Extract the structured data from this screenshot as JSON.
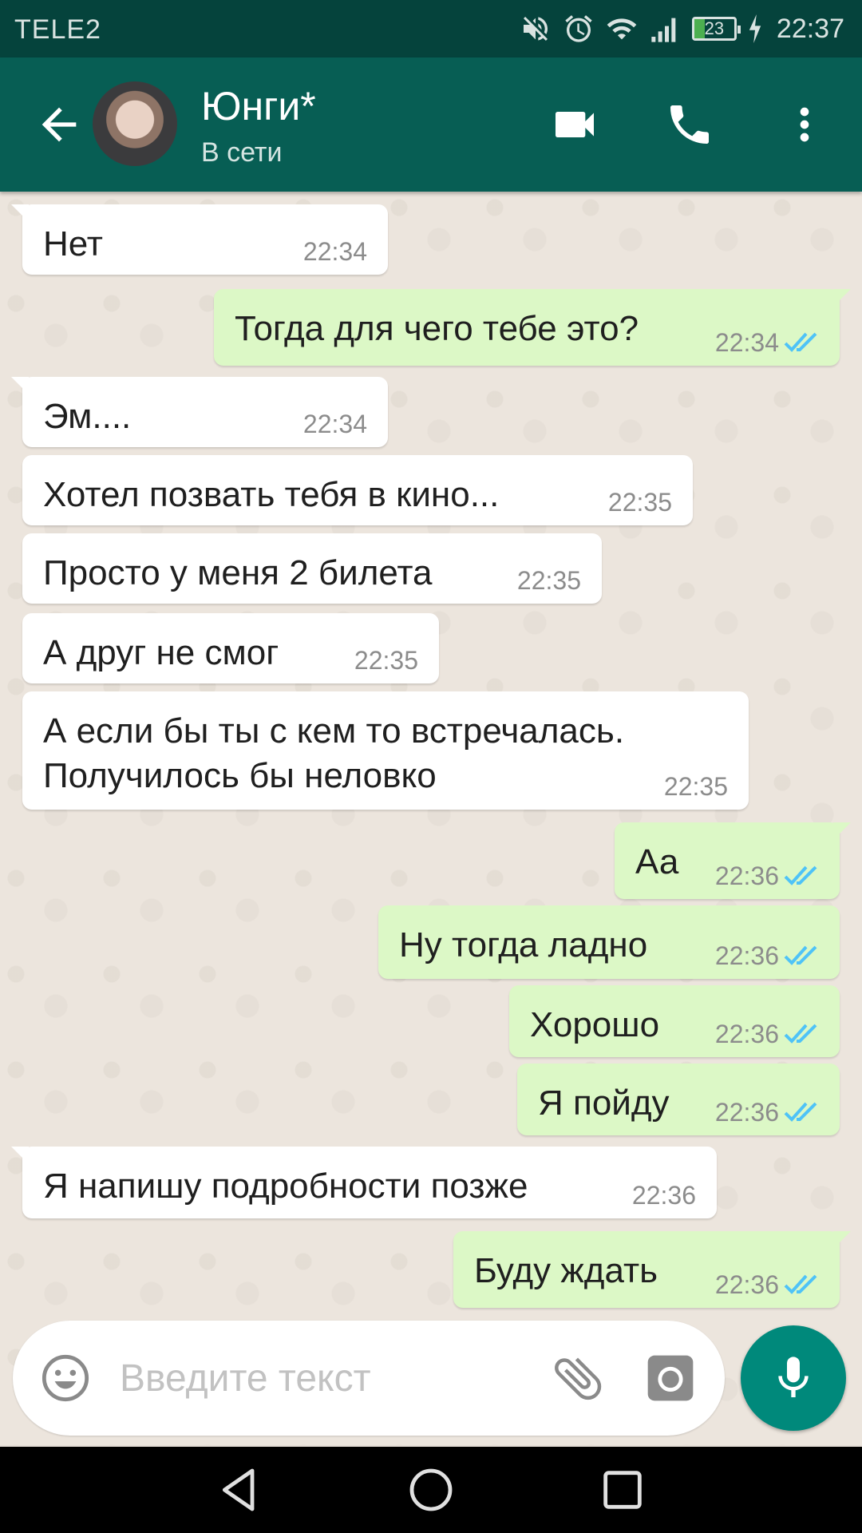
{
  "status_bar": {
    "carrier": "TELE2",
    "battery": "23",
    "time": "22:37"
  },
  "header": {
    "contact_name": "Юнги*",
    "contact_status": "В сети"
  },
  "messages": [
    {
      "dir": "in",
      "text": "Нет",
      "time": "22:34"
    },
    {
      "dir": "out",
      "text": "Тогда для чего тебе это?",
      "time": "22:34",
      "read": true
    },
    {
      "dir": "in",
      "text": "Эм....",
      "time": "22:34"
    },
    {
      "dir": "in",
      "text": "Хотел позвать тебя в кино...",
      "time": "22:35"
    },
    {
      "dir": "in",
      "text": "Просто у меня 2 билета",
      "time": "22:35"
    },
    {
      "dir": "in",
      "text": "А друг не смог",
      "time": "22:35"
    },
    {
      "dir": "in",
      "text": "А если бы ты с кем то встречалась.\nПолучилось бы неловко",
      "time": "22:35"
    },
    {
      "dir": "out",
      "text": "Аа",
      "time": "22:36",
      "read": true
    },
    {
      "dir": "out",
      "text": "Ну тогда ладно",
      "time": "22:36",
      "read": true
    },
    {
      "dir": "out",
      "text": "Хорошо",
      "time": "22:36",
      "read": true
    },
    {
      "dir": "out",
      "text": "Я пойду",
      "time": "22:36",
      "read": true
    },
    {
      "dir": "in",
      "text": "Я напишу подробности позже",
      "time": "22:36"
    },
    {
      "dir": "out",
      "text": "Буду ждать",
      "time": "22:36",
      "read": true
    }
  ],
  "composer": {
    "placeholder": "Введите текст"
  },
  "colors": {
    "header": "#075e54",
    "status_bar": "#05433c",
    "outgoing_bubble": "#dcf8c6",
    "incoming_bubble": "#ffffff",
    "read_ticks": "#4fc3f7",
    "mic_button": "#00897b"
  },
  "icons": [
    "back-arrow-icon",
    "video-call-icon",
    "phone-icon",
    "more-vert-icon",
    "emoji-icon",
    "attach-icon",
    "camera-icon",
    "mic-icon",
    "nav-back-icon",
    "nav-home-icon",
    "nav-recents-icon"
  ]
}
